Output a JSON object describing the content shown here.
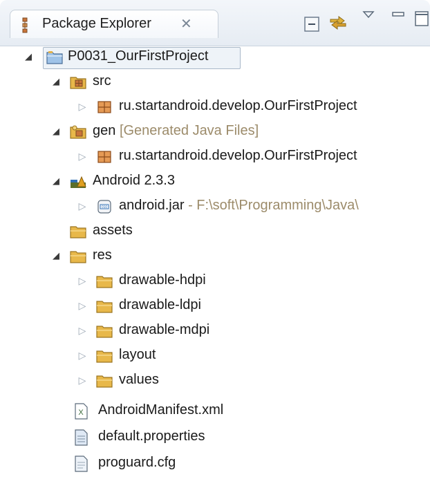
{
  "view": {
    "title": "Package Explorer",
    "close_glyph": "✕",
    "toolbar": [
      "collapse-all-icon",
      "link-with-editor-icon",
      "view-menu-icon",
      "minimize-icon",
      "maximize-icon"
    ]
  },
  "tree": [
    {
      "label": "P0031_OurFirstProject",
      "icon": "project-icon",
      "expanded": true
    },
    {
      "label": "src",
      "icon": "source-folder-icon",
      "expanded": true
    },
    {
      "label": "ru.startandroid.develop.OurFirstProject",
      "icon": "package-icon",
      "expanded": false
    },
    {
      "label": "gen",
      "decoration": "[Generated Java Files]",
      "icon": "generated-folder-icon",
      "expanded": true
    },
    {
      "label": "ru.startandroid.develop.OurFirstProject",
      "icon": "package-icon",
      "expanded": false
    },
    {
      "label": "Android 2.3.3",
      "icon": "android-library-icon",
      "expanded": true
    },
    {
      "label": "android.jar",
      "decoration": "- F:\\soft\\Programming\\Java\\",
      "icon": "jar-icon",
      "expanded": false
    },
    {
      "label": "assets",
      "icon": "folder-icon"
    },
    {
      "label": "res",
      "icon": "folder-icon",
      "expanded": true
    },
    {
      "label": "drawable-hdpi",
      "icon": "folder-icon",
      "expanded": false
    },
    {
      "label": "drawable-ldpi",
      "icon": "folder-icon",
      "expanded": false
    },
    {
      "label": "drawable-mdpi",
      "icon": "folder-icon",
      "expanded": false
    },
    {
      "label": "layout",
      "icon": "folder-icon",
      "expanded": false
    },
    {
      "label": "values",
      "icon": "folder-icon",
      "expanded": false
    },
    {
      "label": "AndroidManifest.xml",
      "icon": "xml-file-icon"
    },
    {
      "label": "default.properties",
      "icon": "properties-file-icon"
    },
    {
      "label": "proguard.cfg",
      "icon": "text-file-icon"
    }
  ],
  "colors": {
    "folder": "#e8b84a",
    "package": "#c9743a",
    "decoration": "#9c8b6a",
    "header_bg": "#e6ecf3"
  }
}
